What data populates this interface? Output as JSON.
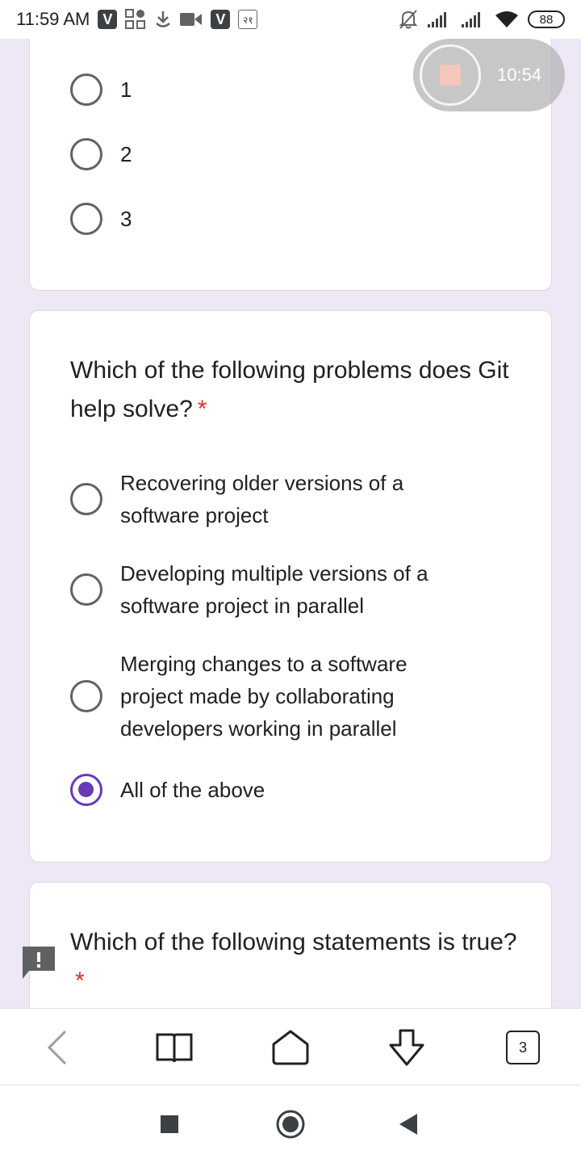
{
  "status_bar": {
    "time": "11:59 AM",
    "v_badge": "V",
    "rupee_label": "२१",
    "battery": "88",
    "icons": [
      "v-app-icon",
      "apps-grid-icon",
      "download-icon",
      "video-camera-icon",
      "v-app-icon",
      "rupee-icon",
      "mute-bell-icon",
      "signal-icon",
      "signal-icon",
      "wifi-icon",
      "battery-icon"
    ]
  },
  "recorder": {
    "time": "10:54"
  },
  "card1": {
    "options": [
      "1",
      "2",
      "3"
    ]
  },
  "card2": {
    "question": "Which of the following problems does Git help solve?",
    "required_marker": "*",
    "options": [
      "Recovering older versions of a software project",
      "Developing multiple versions of a software project in parallel",
      "Merging changes to a software project made by collaborating developers working in parallel",
      "All of the above"
    ],
    "selected_index": 3
  },
  "card3": {
    "question": "Which of the following statements is true?",
    "required_marker": "*"
  },
  "browser_bar": {
    "tab_count": "3",
    "icons": [
      "back-icon",
      "reading-list-icon",
      "home-icon",
      "download-arrow-icon",
      "tab-switcher-icon"
    ]
  },
  "system_nav": {
    "icons": [
      "recents-icon",
      "home-circle-icon",
      "back-triangle-icon"
    ]
  },
  "colors": {
    "accent": "#673ab7",
    "background": "#ede7f6",
    "required": "#d93025"
  }
}
